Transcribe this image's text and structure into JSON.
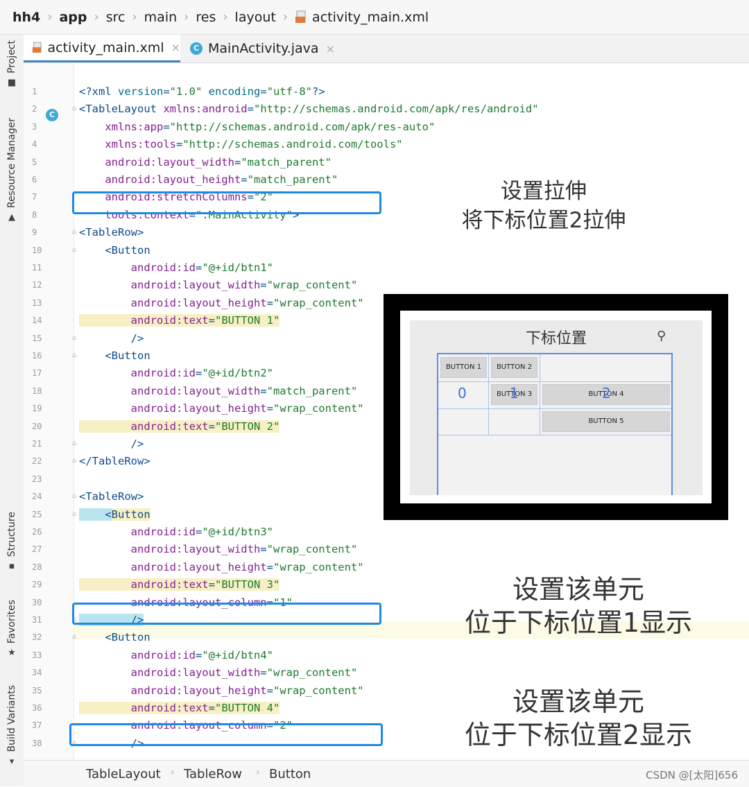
{
  "breadcrumb": {
    "items": [
      "hh4",
      "app",
      "src",
      "main",
      "res",
      "layout",
      "activity_main.xml"
    ]
  },
  "sidebar": {
    "tabs": [
      "Project",
      "Resource Manager",
      "Structure",
      "Favorites",
      "Build Variants"
    ]
  },
  "tabs": [
    {
      "label": "activity_main.xml",
      "close": "×"
    },
    {
      "label": "MainActivity.java",
      "close": "×"
    }
  ],
  "gutter": {
    "lines": [
      "1",
      "2",
      "3",
      "4",
      "5",
      "6",
      "7",
      "8",
      "9",
      "10",
      "11",
      "12",
      "13",
      "14",
      "15",
      "16",
      "17",
      "18",
      "19",
      "20",
      "21",
      "22",
      "23",
      "24",
      "25",
      "26",
      "27",
      "28",
      "29",
      "30",
      "31",
      "32",
      "33",
      "34",
      "35",
      "36",
      "37",
      "38"
    ],
    "class_marker": "C"
  },
  "code": {
    "l1": {
      "a": "<?xml ",
      "b": "version",
      "c": "=",
      "d": "\"1.0\"",
      "e": " encoding",
      "f": "=",
      "g": "\"utf-8\"",
      "h": "?>"
    },
    "l2": {
      "a": "<TableLayout ",
      "b": "xmlns:android",
      "c": "=",
      "d": "\"http://schemas.android.com/apk/res/android\""
    },
    "l3": {
      "a": "    xmlns:app",
      "b": "=",
      "c": "\"http://schemas.android.com/apk/res-auto\""
    },
    "l4": {
      "a": "    xmlns:",
      "b": "tools",
      "c": "=",
      "d": "\"http://schemas.android.com/tools\""
    },
    "l5": {
      "a": "    android:",
      "b": "layout_width",
      "c": "=",
      "d": "\"match_parent\""
    },
    "l6": {
      "a": "    android:",
      "b": "layout_height",
      "c": "=",
      "d": "\"match_parent\""
    },
    "l7": {
      "a": "    android:",
      "b": "stretchColumns",
      "c": "=",
      "d": "\"2\""
    },
    "l8": {
      "a": "    tools:",
      "b": "context",
      "c": "=",
      "d": "\".MainActivity\"",
      "e": ">"
    },
    "l9": {
      "a": "<TableRow",
      "b": ">"
    },
    "l10": {
      "a": "    <",
      "b": "Button"
    },
    "l11": {
      "a": "        android:",
      "b": "id",
      "c": "=",
      "d": "\"@+id/btn1\""
    },
    "l12": {
      "a": "        android:",
      "b": "layout_width",
      "c": "=",
      "d": "\"wrap_content\""
    },
    "l13": {
      "a": "        android:",
      "b": "layout_height",
      "c": "=",
      "d": "\"wrap_content\""
    },
    "l14": {
      "a": "        android:",
      "b": "text",
      "c": "=",
      "d": "\"BUTTON 1\""
    },
    "l15": {
      "a": "        />"
    },
    "l16": {
      "a": "    <",
      "b": "Button"
    },
    "l17": {
      "a": "        android:",
      "b": "id",
      "c": "=",
      "d": "\"@+id/btn2\""
    },
    "l18": {
      "a": "        android:",
      "b": "layout_width",
      "c": "=",
      "d": "\"match_parent\""
    },
    "l19": {
      "a": "        android:",
      "b": "layout_height",
      "c": "=",
      "d": "\"wrap_content\""
    },
    "l20": {
      "a": "        android:",
      "b": "text",
      "c": "=",
      "d": "\"BUTTON 2\""
    },
    "l21": {
      "a": "        />"
    },
    "l22": {
      "a": "</TableRow",
      "b": ">"
    },
    "l24": {
      "a": "<TableRow",
      "b": ">"
    },
    "l25": {
      "a": "    <",
      "b": "Button"
    },
    "l26": {
      "a": "        android:",
      "b": "id",
      "c": "=",
      "d": "\"@+id/btn3\""
    },
    "l27": {
      "a": "        android:",
      "b": "layout_width",
      "c": "=",
      "d": "\"wrap_content\""
    },
    "l28": {
      "a": "        android:",
      "b": "layout_height",
      "c": "=",
      "d": "\"wrap_content\""
    },
    "l29": {
      "a": "        android:",
      "b": "text",
      "c": "=",
      "d": "\"BUTTON 3\""
    },
    "l30": {
      "a": "        android:",
      "b": "layout_column",
      "c": "=",
      "d": "\"1\""
    },
    "l31": {
      "a": "        />"
    },
    "l32": {
      "a": "    <",
      "b": "Button"
    },
    "l33": {
      "a": "        android:",
      "b": "id",
      "c": "=",
      "d": "\"@+id/btn4\""
    },
    "l34": {
      "a": "        android:",
      "b": "layout_width",
      "c": "=",
      "d": "\"wrap_content\""
    },
    "l35": {
      "a": "        android:",
      "b": "layout_height",
      "c": "=",
      "d": "\"wrap_content\""
    },
    "l36": {
      "a": "        android:",
      "b": "text",
      "c": "=",
      "d": "\"BUTTON 4\""
    },
    "l37": {
      "a": "        android:",
      "b": "layout_column",
      "c": "=",
      "d": "\"2\""
    },
    "l38": {
      "a": "        />"
    }
  },
  "annotations": {
    "stretch_line1": "设置拉伸",
    "stretch_line2": "将下标位置2拉伸",
    "col1_line1": "设置该单元",
    "col1_line2": "位于下标位置1显示",
    "col2_line1": "设置该单元",
    "col2_line2": "位于下标位置2显示"
  },
  "preview": {
    "title": "下标位置",
    "buttons": [
      "BUTTON 1",
      "BUTTON 2",
      "BUTTON 3",
      "BUTTON 4",
      "BUTTON 5"
    ],
    "index_labels": [
      "0",
      "1",
      "2"
    ]
  },
  "bottom_breadcrumb": [
    "TableLayout",
    "TableRow",
    "Button"
  ],
  "watermark": "CSDN @[太阳]656",
  "colors": {
    "accent": "#1e88e5",
    "tag": "#0c4c8c",
    "attribute": "#84208f",
    "value": "#1d7a2f"
  }
}
